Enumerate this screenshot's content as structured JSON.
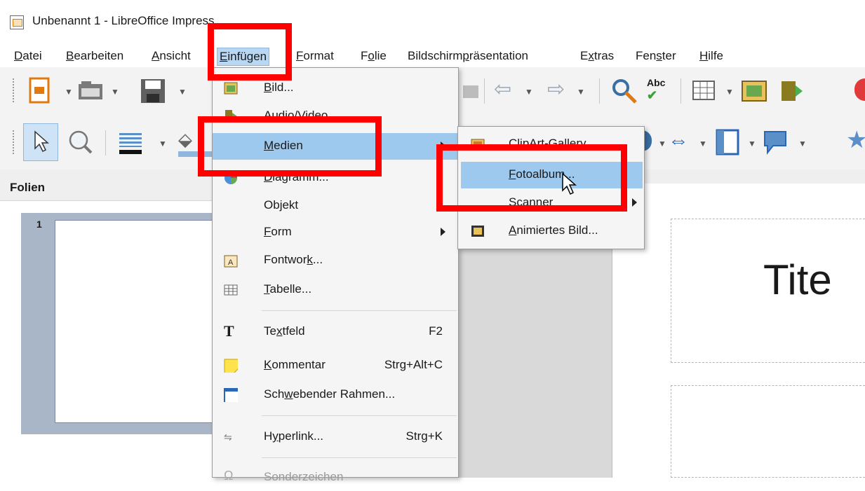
{
  "window": {
    "title": "Unbenannt 1 - LibreOffice Impress"
  },
  "menubar": {
    "items": [
      {
        "label": "Datei",
        "u": "D",
        "rest": "atei"
      },
      {
        "label": "Bearbeiten",
        "u": "B",
        "rest": "earbeiten"
      },
      {
        "label": "Ansicht",
        "u": "A",
        "rest": "nsicht"
      },
      {
        "label": "Einfügen",
        "u": "E",
        "rest": "infügen"
      },
      {
        "label": "Format",
        "u": "F",
        "rest": "ormat"
      },
      {
        "label": "Folie",
        "pre": "F",
        "u": "o",
        "rest": "lie"
      },
      {
        "label": "Bildschirmpräsentation",
        "pre": "Bildschirm",
        "u": "p",
        "rest": "räsentation"
      },
      {
        "label": "Extras",
        "pre": "E",
        "u": "x",
        "rest": "tras"
      },
      {
        "label": "Fenster",
        "pre": "Fen",
        "u": "s",
        "rest": "ter"
      },
      {
        "label": "Hilfe",
        "u": "H",
        "rest": "ilfe"
      }
    ]
  },
  "insert_menu": {
    "items": [
      {
        "label": "Bild...",
        "u": "B",
        "rest": "ild...",
        "icon": "image-icon"
      },
      {
        "label": "Audio/Video",
        "u": "A",
        "rest": "udio/Video",
        "icon": "film-icon"
      },
      {
        "label": "Medien",
        "u": "M",
        "rest": "edien",
        "submenu": true
      },
      {
        "label": "Diagramm...",
        "u": "D",
        "rest": "iagramm...",
        "icon": "pie-chart-icon"
      },
      {
        "label": "Objekt",
        "pre": "Ob",
        "u": "j",
        "rest": "ekt",
        "submenu": true
      },
      {
        "label": "Form",
        "u": "F",
        "rest": "orm",
        "submenu": true
      },
      {
        "label": "Fontwork...",
        "pre": "Fontwor",
        "u": "k",
        "rest": "...",
        "icon": "fontwork-icon"
      },
      {
        "label": "Tabelle...",
        "u": "T",
        "rest": "abelle...",
        "icon": "table-icon"
      },
      {
        "label": "Textfeld",
        "pre": "Te",
        "u": "x",
        "rest": "tfeld",
        "shortcut": "F2",
        "icon": "text-icon"
      },
      {
        "label": "Kommentar",
        "u": "K",
        "rest": "ommentar",
        "shortcut": "Strg+Alt+C",
        "icon": "comment-icon"
      },
      {
        "label": "Schwebender Rahmen...",
        "pre": "Sch",
        "u": "w",
        "rest": "ebender Rahmen...",
        "icon": "frame-icon"
      },
      {
        "label": "Hyperlink...",
        "pre": "H",
        "u": "y",
        "rest": "perlink...",
        "shortcut": "Strg+K",
        "icon": "hyperlink-icon"
      },
      {
        "label": "Sonderzeichen",
        "disabled": true,
        "icon": "omega-icon"
      }
    ]
  },
  "media_submenu": {
    "items": [
      {
        "label": "ClipArt-Gallery",
        "icon": "gallery-icon"
      },
      {
        "label": "Fotoalbum...",
        "u": "F",
        "rest": "otoalbum..."
      },
      {
        "label": "Scanner",
        "submenu": true
      },
      {
        "label": "Animiertes Bild...",
        "u": "A",
        "rest": "nimiertes Bild...",
        "icon": "animated-image-icon"
      }
    ]
  },
  "slides_panel": {
    "title": "Folien",
    "slide_number": "1"
  },
  "slide": {
    "title_text": "Tite"
  },
  "colors": {
    "highlight": "#9ec9ef",
    "red_annotation": "#ff0000",
    "menu_bg": "#f5f5f5"
  }
}
